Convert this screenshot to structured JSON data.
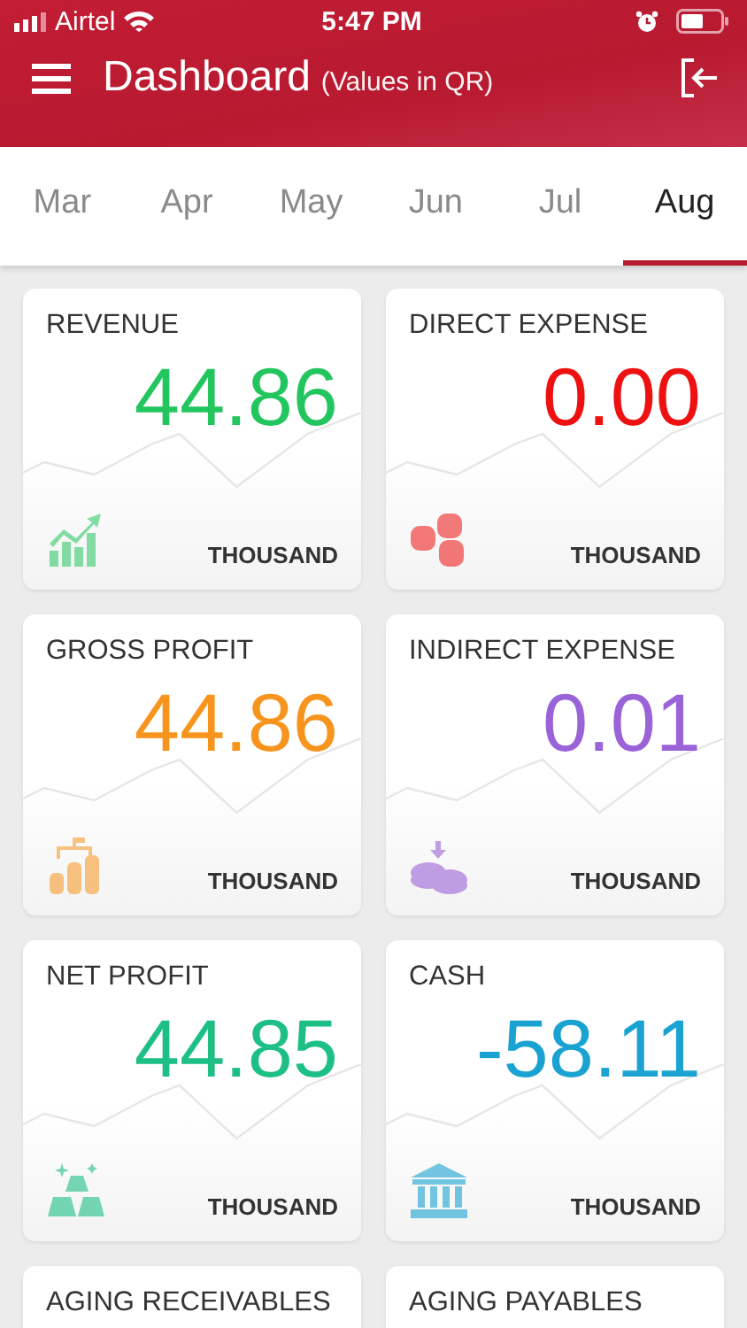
{
  "status_bar": {
    "carrier": "Airtel",
    "time": "5:47 PM"
  },
  "header": {
    "title": "Dashboard",
    "subtitle": "(Values in QR)"
  },
  "tabs": [
    {
      "label": "Mar",
      "selected": false
    },
    {
      "label": "Apr",
      "selected": false
    },
    {
      "label": "May",
      "selected": false
    },
    {
      "label": "Jun",
      "selected": false
    },
    {
      "label": "Jul",
      "selected": false
    },
    {
      "label": "Aug",
      "selected": true
    }
  ],
  "cards": [
    {
      "title": "REVENUE",
      "value": "44.86",
      "unit": "THOUSAND",
      "color": "#22c55e"
    },
    {
      "title": "DIRECT EXPENSE",
      "value": "0.00",
      "unit": "THOUSAND",
      "color": "#ee1111"
    },
    {
      "title": "GROSS PROFIT",
      "value": "44.86",
      "unit": "THOUSAND",
      "color": "#f7941d"
    },
    {
      "title": "INDIRECT EXPENSE",
      "value": "0.01",
      "unit": "THOUSAND",
      "color": "#9b63d8"
    },
    {
      "title": "NET PROFIT",
      "value": "44.85",
      "unit": "THOUSAND",
      "color": "#1dbf84"
    },
    {
      "title": "CASH",
      "value": "-58.11",
      "unit": "THOUSAND",
      "color": "#1aa3d1"
    },
    {
      "title": "AGING RECEIVABLES"
    },
    {
      "title": "AGING PAYABLES"
    }
  ]
}
